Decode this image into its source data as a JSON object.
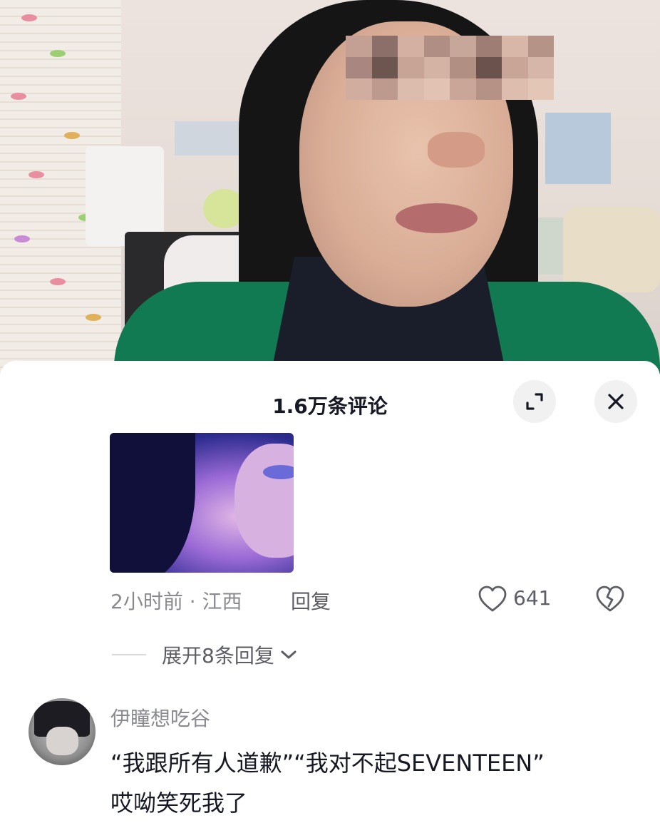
{
  "sheet": {
    "title": "1.6万条评论"
  },
  "comment_top": {
    "time_location": "2小时前 · 江西",
    "reply_label": "回复",
    "like_count": "641",
    "expand_replies": "展开8条回复"
  },
  "comment_next": {
    "username": "伊瞳想吃谷",
    "text_line1": "“我跟所有人道歉”“我对不起SEVENTEEN”",
    "text_line2": "哎呦笑死我了"
  },
  "colors": {
    "text_primary": "#161823",
    "text_secondary": "#8a8b91",
    "button_bg": "#f1f1f2"
  },
  "icons": {
    "expand": "expand-icon",
    "close": "close-icon",
    "like": "heart-icon",
    "dislike": "broken-heart-icon",
    "chevron": "chevron-down-icon"
  }
}
